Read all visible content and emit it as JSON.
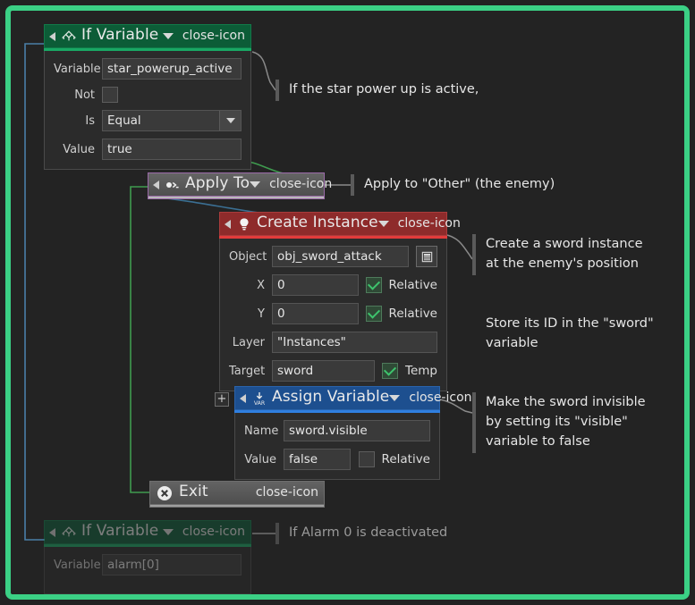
{
  "theme": {
    "frame_color": "#3bd085",
    "canvas_bg": "#232323",
    "if_variable_header": "#0c5c37",
    "apply_to_header": "#5a5a5a",
    "apply_to_border": "#9a6aa8",
    "create_instance_header": "#8e2b2b",
    "create_instance_underline": "#e23b3b",
    "assign_variable_header": "#1d4f8f",
    "assign_variable_underline": "#2f7fe0",
    "exit_header": "#5a5a5a",
    "wire_green": "#3f9b4f",
    "wire_blue": "#4a7fa8",
    "wire_gray": "#8a8a8a"
  },
  "blocks": {
    "if_variable_top": {
      "title": "If Variable",
      "icon": "branch-icon",
      "caret": "chevron-down-icon",
      "close": "close-icon",
      "collapse": "collapse-triangle-icon",
      "fields": {
        "variable_label": "Variable",
        "variable_value": "star_powerup_active",
        "not_label": "Not",
        "not_checked": false,
        "is_label": "Is",
        "is_value": "Equal",
        "value_label": "Value",
        "value_value": "true"
      }
    },
    "apply_to": {
      "title": "Apply To",
      "icon": "apply-to-icon",
      "caret": "chevron-down-icon",
      "close": "close-icon",
      "collapse": "collapse-triangle-icon"
    },
    "create_instance": {
      "title": "Create Instance",
      "icon": "lightbulb-icon",
      "caret": "chevron-down-icon",
      "close": "close-icon",
      "collapse": "collapse-triangle-icon",
      "fields": {
        "object_label": "Object",
        "object_value": "obj_sword_attack",
        "object_menu_icon": "list-picker-icon",
        "x_label": "X",
        "x_value": "0",
        "x_relative_label": "Relative",
        "x_relative_checked": true,
        "y_label": "Y",
        "y_value": "0",
        "y_relative_label": "Relative",
        "y_relative_checked": true,
        "layer_label": "Layer",
        "layer_value": "\"Instances\"",
        "target_label": "Target",
        "target_value": "sword",
        "temp_label": "Temp",
        "temp_checked": true
      }
    },
    "assign_variable": {
      "title": "Assign Variable",
      "icon": "var-assign-icon",
      "caret": "chevron-down-icon",
      "close": "close-icon",
      "collapse": "collapse-triangle-icon",
      "add_button": "+",
      "fields": {
        "name_label": "Name",
        "name_value": "sword.visible",
        "value_label": "Value",
        "value_value": "false",
        "relative_label": "Relative",
        "relative_checked": false
      }
    },
    "exit": {
      "title": "Exit",
      "icon": "exit-circle-x-icon",
      "close": "close-icon"
    },
    "if_variable_bottom": {
      "title": "If Variable",
      "icon": "branch-icon",
      "caret": "chevron-down-icon",
      "close": "close-icon",
      "collapse": "collapse-triangle-icon",
      "fields": {
        "variable_label": "Variable",
        "variable_value": "alarm[0]"
      }
    }
  },
  "annotations": {
    "note1": "If the star power up is active,",
    "note2": "Apply to \"Other\" (the enemy)",
    "note3": "Create a sword instance\nat the enemy's position",
    "note4": "Store its ID in the \"sword\"\nvariable",
    "note5": "Make the sword invisible\nby setting its \"visible\"\nvariable to false",
    "note6": "If Alarm 0 is deactivated"
  }
}
